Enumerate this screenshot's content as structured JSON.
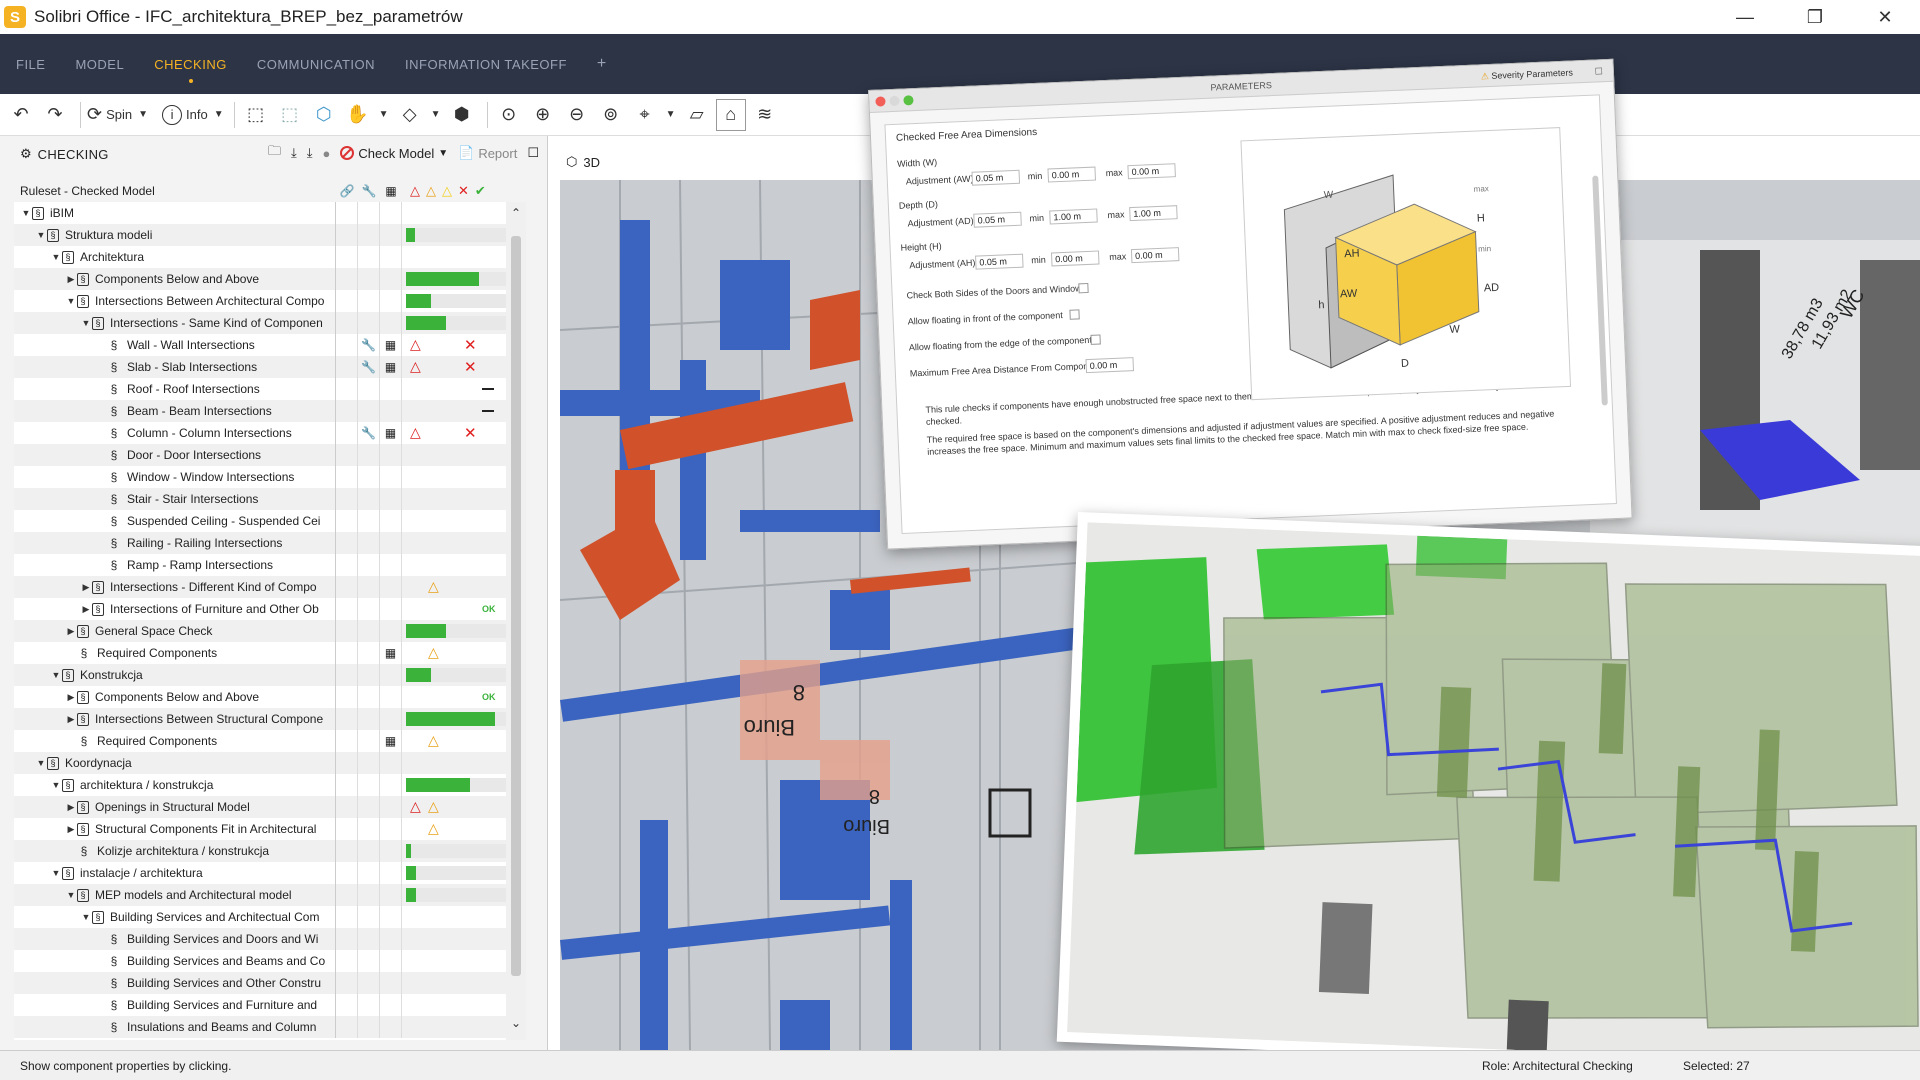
{
  "window": {
    "logo_letter": "S",
    "title": "Solibri Office - IFC_architektura_BREP_bez_parametrów",
    "minimize": "—",
    "restore": "❐",
    "close": "✕"
  },
  "menu": {
    "items": [
      "FILE",
      "MODEL",
      "CHECKING",
      "COMMUNICATION",
      "INFORMATION TAKEOFF",
      "+"
    ],
    "active": "CHECKING"
  },
  "toolbar": {
    "spin_label": "Spin",
    "info_label": "Info"
  },
  "checking_panel": {
    "title": "CHECKING",
    "check_model_label": "Check Model",
    "report_label": "Report",
    "ruleset_header": "Ruleset - Checked Model"
  },
  "tree": [
    {
      "label": "iBIM",
      "indent": 0,
      "icon": "ruleset",
      "exp": "open",
      "bar": null,
      "a": "",
      "b": "",
      "r1": "",
      "r2": "",
      "r3": "",
      "r4": "",
      "ok": ""
    },
    {
      "label": "Struktura modeli",
      "indent": 1,
      "icon": "ruleset",
      "exp": "open",
      "bar": 0.08
    },
    {
      "label": "Architektura",
      "indent": 2,
      "icon": "ruleset",
      "exp": "open",
      "bar": null
    },
    {
      "label": "Components Below and Above",
      "indent": 3,
      "icon": "ruleset",
      "exp": "closed",
      "bar": 0.64
    },
    {
      "label": "Intersections Between Architectural Compo",
      "indent": 3,
      "icon": "ruleset",
      "exp": "open",
      "bar": 0.22
    },
    {
      "label": "Intersections - Same Kind of Componen",
      "indent": 4,
      "icon": "ruleset",
      "exp": "open",
      "bar": 0.35
    },
    {
      "label": "Wall - Wall Intersections",
      "indent": 5,
      "icon": "rule",
      "wrench": true,
      "table": true,
      "warn_red": true,
      "x": true
    },
    {
      "label": "Slab - Slab Intersections",
      "indent": 5,
      "icon": "rule",
      "wrench": true,
      "table": true,
      "warn_red": true,
      "x": true
    },
    {
      "label": "Roof - Roof Intersections",
      "indent": 5,
      "icon": "rule",
      "dash": true
    },
    {
      "label": "Beam - Beam Intersections",
      "indent": 5,
      "icon": "rule",
      "dash": true
    },
    {
      "label": "Column - Column Intersections",
      "indent": 5,
      "icon": "rule",
      "wrench": true,
      "table": true,
      "warn_red": true,
      "x": true
    },
    {
      "label": "Door - Door Intersections",
      "indent": 5,
      "icon": "rule"
    },
    {
      "label": "Window - Window Intersections",
      "indent": 5,
      "icon": "rule"
    },
    {
      "label": "Stair - Stair Intersections",
      "indent": 5,
      "icon": "rule"
    },
    {
      "label": "Suspended Ceiling - Suspended Cei",
      "indent": 5,
      "icon": "rule"
    },
    {
      "label": "Railing - Railing Intersections",
      "indent": 5,
      "icon": "rule"
    },
    {
      "label": "Ramp - Ramp Intersections",
      "indent": 5,
      "icon": "rule"
    },
    {
      "label": "Intersections - Different Kind of Compo",
      "indent": 4,
      "icon": "ruleset",
      "exp": "closed",
      "warn_yellow": true
    },
    {
      "label": "Intersections of Furniture and Other Ob",
      "indent": 4,
      "icon": "ruleset",
      "exp": "closed",
      "ok": "OK"
    },
    {
      "label": "General Space Check",
      "indent": 3,
      "icon": "ruleset",
      "exp": "closed",
      "bar": 0.35
    },
    {
      "label": "Required Components",
      "indent": 3,
      "icon": "rule",
      "table": true,
      "warn_yellow": true
    },
    {
      "label": "Konstrukcja",
      "indent": 2,
      "icon": "ruleset",
      "exp": "open",
      "bar": 0.22
    },
    {
      "label": "Components Below and Above",
      "indent": 3,
      "icon": "ruleset",
      "exp": "closed",
      "ok": "OK"
    },
    {
      "label": "Intersections Between Structural Compone",
      "indent": 3,
      "icon": "ruleset",
      "exp": "closed",
      "bar": 0.78
    },
    {
      "label": "Required Components",
      "indent": 3,
      "icon": "rule",
      "table": true,
      "warn_yellow": true
    },
    {
      "label": "Koordynacja",
      "indent": 1,
      "icon": "ruleset",
      "exp": "open",
      "bar": null
    },
    {
      "label": "architektura / konstrukcja",
      "indent": 2,
      "icon": "ruleset",
      "exp": "open",
      "bar": 0.56
    },
    {
      "label": "Openings in Structural Model",
      "indent": 3,
      "icon": "ruleset",
      "exp": "closed",
      "warn_red": true,
      "warn_yellow": true
    },
    {
      "label": "Structural Components Fit in Architectural",
      "indent": 3,
      "icon": "ruleset",
      "exp": "closed",
      "warn_yellow": true
    },
    {
      "label": "Kolizje architektura / konstrukcja",
      "indent": 3,
      "icon": "rule",
      "bar": 0.04
    },
    {
      "label": "instalacje / architektura",
      "indent": 2,
      "icon": "ruleset",
      "exp": "open",
      "bar": 0.09
    },
    {
      "label": "MEP models and Architectural model",
      "indent": 3,
      "icon": "ruleset",
      "exp": "open",
      "bar": 0.09
    },
    {
      "label": "Building Services and Architectual Com",
      "indent": 4,
      "icon": "ruleset",
      "exp": "open"
    },
    {
      "label": "Building Services and Doors and Wi",
      "indent": 5,
      "icon": "rule"
    },
    {
      "label": "Building Services and Beams and Co",
      "indent": 5,
      "icon": "rule"
    },
    {
      "label": "Building Services and Other Constru",
      "indent": 5,
      "icon": "rule"
    },
    {
      "label": "Building Services and Furniture and",
      "indent": 5,
      "icon": "rule"
    },
    {
      "label": "Insulations and Beams and Column",
      "indent": 5,
      "icon": "rule"
    }
  ],
  "view": {
    "tab_label": "3D",
    "room_label_1": "Biuro",
    "room_num_1": "8",
    "room_label_2": "Biuro",
    "room_num_2": "8",
    "area_1": "11,93 m2",
    "area_2": "38,78 m3",
    "area_3": "WC"
  },
  "parameters": {
    "window_title": "PARAMETERS",
    "severity_label": "Severity Parameters",
    "section_title": "Checked Free Area Dimensions",
    "width_label": "Width (W)",
    "depth_label": "Depth (D)",
    "height_label": "Height (H)",
    "adj_w_label": "Adjustment (AW)",
    "adj_d_label": "Adjustment (AD)",
    "adj_h_label": "Adjustment (AH)",
    "min_label": "min",
    "max_label": "max",
    "w_adj": "0.05 m",
    "w_min": "0.00 m",
    "w_max": "0.00 m",
    "d_adj": "0.05 m",
    "d_min": "1.00 m",
    "d_max": "1.00 m",
    "h_adj": "0.05 m",
    "h_min": "0.00 m",
    "h_max": "0.00 m",
    "check_both_sides": "Check Both Sides of the Doors and Windows",
    "floating_front": "Allow floating in front of the component",
    "floating_edge": "Allow floating from the edge of the component",
    "max_distance_label": "Maximum Free Area Distance From Component",
    "max_distance_value": "0.00 m",
    "desc_1": "This rule checks if components have enough unobstructed free space next to them. If walls are found near components, only the directions away from walls are checked.",
    "desc_2": "The required free space is based on the component's dimensions and adjusted if adjustment values are specified. A positive adjustment reduces and negative increases the free space. Minimum and maximum values sets final limits to the checked free space. Match min with max to check fixed-size free space.",
    "diagram_labels": {
      "h": "h",
      "W": "W",
      "D": "D",
      "H": "H",
      "AH": "AH",
      "AW": "AW",
      "AD": "AD",
      "max": "max",
      "min": "min"
    }
  },
  "status": {
    "left": "Show component properties by clicking.",
    "role": "Role: Architectural Checking",
    "selected": "Selected: 27"
  },
  "colors": {
    "menubar_bg": "#2c3446",
    "accent": "#f5b324",
    "bar_green": "#3bb33b",
    "warn_red": "#d22222",
    "warn_yellow": "#e9a21b"
  }
}
